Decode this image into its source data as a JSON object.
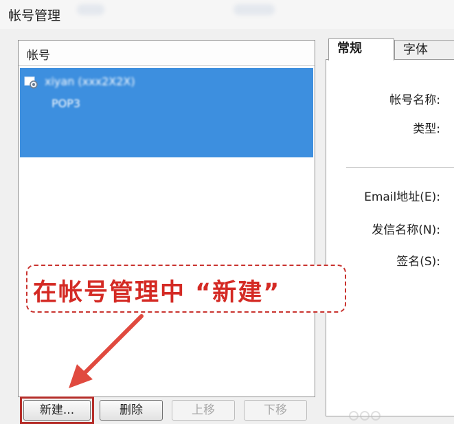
{
  "window": {
    "title": "帐号管理"
  },
  "account_list": {
    "header": "帐号",
    "items": [
      {
        "name": "xiyan (xxx2X2X)",
        "sub": "POP3",
        "selected": true,
        "icon": "account-gear-icon"
      }
    ]
  },
  "annotation": {
    "text": "在帐号管理中 “新建”",
    "color": "#d42a24"
  },
  "buttons": {
    "new": "新建...",
    "delete": "删除",
    "move_up": "上移",
    "move_down": "下移"
  },
  "tabs": {
    "general": "常规",
    "font": "字体"
  },
  "fields": {
    "account_name": "帐号名称:",
    "type": "类型:",
    "email": "Email地址(E):",
    "sender_name": "发信名称(N):",
    "signature": "签名(S):"
  },
  "colors": {
    "selection": "#3d8fdf",
    "annotation": "#d42a24"
  }
}
